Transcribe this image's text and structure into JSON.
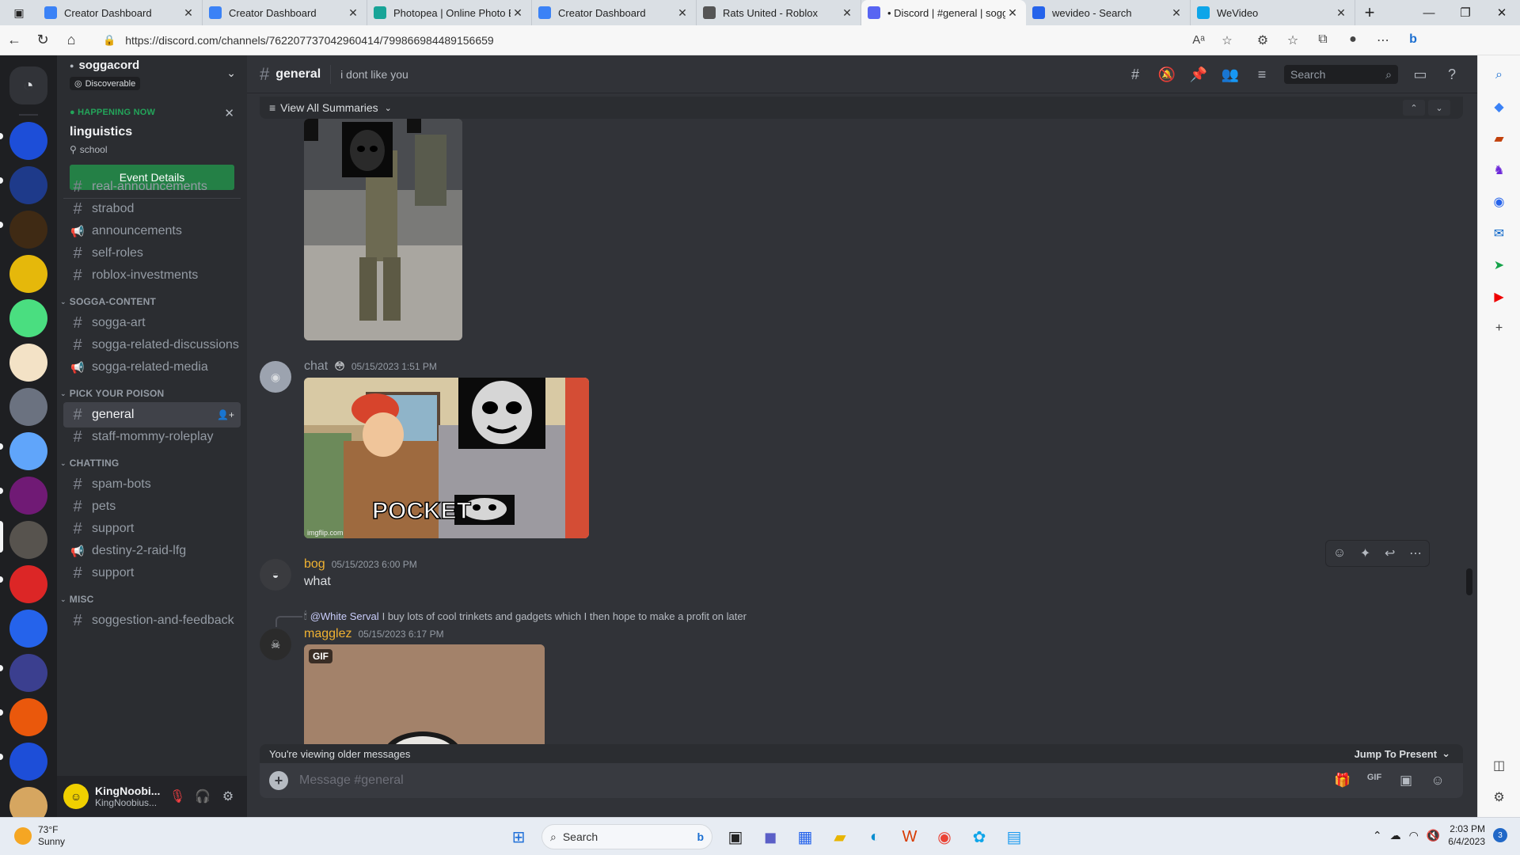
{
  "browser": {
    "tabs": [
      {
        "label": "Creator Dashboard",
        "color": "#3b82f6",
        "active": false
      },
      {
        "label": "Creator Dashboard",
        "color": "#3b82f6",
        "active": false
      },
      {
        "label": "Photopea | Online Photo E",
        "color": "#18a497",
        "active": false
      },
      {
        "label": "Creator Dashboard",
        "color": "#3b82f6",
        "active": false
      },
      {
        "label": "Rats United - Roblox",
        "color": "#555555",
        "active": false
      },
      {
        "label": "• Discord | #general | sogg",
        "color": "#5865f2",
        "active": true
      },
      {
        "label": "wevideo - Search",
        "color": "#2563eb",
        "active": false
      },
      {
        "label": "WeVideo",
        "color": "#0ea5e9",
        "active": false
      }
    ],
    "url": "https://discord.com/channels/762207737042960414/799866984489156659"
  },
  "server": {
    "name": "soggacord",
    "badge": "Discoverable"
  },
  "event": {
    "status": "HAPPENING NOW",
    "title": "linguistics",
    "location": "school",
    "button": "Event Details"
  },
  "channels": {
    "top": [
      {
        "name": "real-announcements",
        "icon": "#"
      },
      {
        "name": "strabod",
        "icon": "#"
      },
      {
        "name": "announcements",
        "icon": "📢"
      },
      {
        "name": "self-roles",
        "icon": "#"
      },
      {
        "name": "roblox-investments",
        "icon": "#"
      }
    ],
    "cat1": "SOGGA-CONTENT",
    "cat1_items": [
      {
        "name": "sogga-art",
        "icon": "#"
      },
      {
        "name": "sogga-related-discussions",
        "icon": "#"
      },
      {
        "name": "sogga-related-media",
        "icon": "📢"
      }
    ],
    "cat2": "PICK YOUR POISON",
    "cat2_items": [
      {
        "name": "general",
        "icon": "#"
      },
      {
        "name": "staff-mommy-roleplay",
        "icon": "#"
      }
    ],
    "cat3": "CHATTING",
    "cat3_items": [
      {
        "name": "spam-bots",
        "icon": "#"
      },
      {
        "name": "pets",
        "icon": "#"
      },
      {
        "name": "support",
        "icon": "#"
      },
      {
        "name": "destiny-2-raid-lfg",
        "icon": "📢"
      },
      {
        "name": "support",
        "icon": "#"
      }
    ],
    "cat4": "MISC",
    "cat4_items": [
      {
        "name": "soggestion-and-feedback",
        "icon": "#"
      }
    ]
  },
  "user": {
    "name": "KingNoobi...",
    "tag": "KingNoobius..."
  },
  "chat": {
    "channel": "general",
    "topic": "i dont like you",
    "search_placeholder": "Search",
    "summaries": "View All Summaries",
    "messages": [
      {
        "author": "chat",
        "time": "05/15/2023 1:51 PM",
        "color": "#949ba4",
        "text": ""
      },
      {
        "author": "bog",
        "time": "05/15/2023 6:00 PM",
        "color": "#f0b232",
        "text": "what"
      },
      {
        "author": "magglez",
        "time": "05/15/2023 6:17 PM",
        "color": "#f0b232",
        "text": ""
      }
    ],
    "reply_mention": "@White Serval",
    "reply_text": "I buy lots of cool trinkets and gadgets which I then hope to make a profit on later",
    "meme_caption": "POCKET",
    "watermark": "imgflip.com",
    "gif_label": "GIF",
    "older_notice": "You're viewing older messages",
    "jump": "Jump To Present",
    "composer_placeholder": "Message #general"
  },
  "taskbar": {
    "temp": "73°F",
    "condition": "Sunny",
    "search": "Search",
    "time": "2:03 PM",
    "date": "6/4/2023",
    "notifications": "3"
  }
}
